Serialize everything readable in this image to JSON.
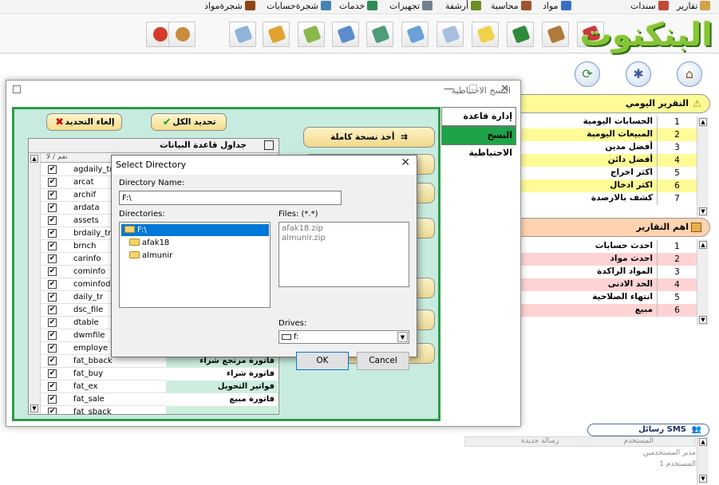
{
  "menu": [
    {
      "label": "تقارير",
      "icon": "report-icon",
      "color": "#d2a24a"
    },
    {
      "label": "سندات",
      "icon": "voucher-icon",
      "color": "#c04a3a"
    },
    {
      "label": "مواد",
      "icon": "items-icon",
      "color": "#3a6fc0"
    },
    {
      "label": "محاسبة",
      "icon": "accounting-icon",
      "color": "#a0522d"
    },
    {
      "label": "أرشفة",
      "icon": "archive-icon",
      "color": "#6b8e23"
    },
    {
      "label": "تجهيزات",
      "icon": "tools-icon",
      "color": "#708090"
    },
    {
      "label": "خدمات",
      "icon": "services-icon",
      "color": "#2e8b57"
    },
    {
      "label": "شجرةحسابات",
      "icon": "accounts-tree-icon",
      "color": "#4682b4"
    },
    {
      "label": "شجرةمواد",
      "icon": "items-tree-icon",
      "color": "#8b4513"
    }
  ],
  "logo_text": "البنكنوت",
  "backup_window": {
    "title": "النسخ الاحتياطية",
    "side_tabs": {
      "db_admin": "إدارة قاعدة البيانات",
      "backups": "النسخ الاحتياطية"
    },
    "select_all": "تحديد الكل",
    "cancel_selection": "إلغاء التحديد",
    "full_backup": "أخذ نسخة كاملة",
    "grid_title": "جداول قاعدة البيانات",
    "col_yes_no": "نعم / لا",
    "check_mark": "✔",
    "rows": [
      {
        "name": "agdaily_tr",
        "desc": ""
      },
      {
        "name": "arcat",
        "desc": ""
      },
      {
        "name": "archif",
        "desc": ""
      },
      {
        "name": "ardata",
        "desc": ""
      },
      {
        "name": "assets",
        "desc": ""
      },
      {
        "name": "brdaily_tr",
        "desc": ""
      },
      {
        "name": "brnch",
        "desc": ""
      },
      {
        "name": "carinfo",
        "desc": ""
      },
      {
        "name": "cominfo",
        "desc": ""
      },
      {
        "name": "cominfodai",
        "desc": ""
      },
      {
        "name": "daily_tr",
        "desc": ""
      },
      {
        "name": "dsc_file",
        "desc": ""
      },
      {
        "name": "dtable",
        "desc": ""
      },
      {
        "name": "dwmfile",
        "desc": ""
      },
      {
        "name": "employe",
        "desc": ""
      },
      {
        "name": "fat_bback",
        "desc": "فاتورة مرتجع شراء"
      },
      {
        "name": "fat_buy",
        "desc": "فاتورة شراء"
      },
      {
        "name": "fat_ex",
        "desc": "فواتير التحويل"
      },
      {
        "name": "fat_sale",
        "desc": "فاتورة مبيع"
      },
      {
        "name": "fat_sback",
        "desc": ""
      }
    ]
  },
  "dialog": {
    "title": "Select Directory",
    "close_glyph": "✕",
    "directory_name_label": "Directory Name:",
    "directory_name_value": "F:\\",
    "directories_label": "Directories:",
    "files_label": "Files: (*.*)",
    "directories": [
      "F:\\",
      "afak18",
      "almunir"
    ],
    "files": [
      "afak18.zip",
      "almunir.zip"
    ],
    "drives_label": "Drives:",
    "drive_value": "f:",
    "ok": "OK",
    "cancel": "Cancel"
  },
  "daily_reports": {
    "header": "التقرير اليومي",
    "accent": "#fffb96",
    "items": [
      {
        "label": "الحسابات اليومية",
        "num": "1"
      },
      {
        "label": "المبيعات اليومية",
        "num": "2"
      },
      {
        "label": "أفضل مدين",
        "num": "3"
      },
      {
        "label": "أفضل دائن",
        "num": "4"
      },
      {
        "label": "اكثر اخراج",
        "num": "5"
      },
      {
        "label": "اكثر ادخال",
        "num": "6"
      },
      {
        "label": "كشف بالارصدة",
        "num": "7"
      }
    ]
  },
  "top_reports": {
    "header": "اهم التقارير",
    "accent": "#ffd3d3",
    "items": [
      {
        "label": "احدث حسابات",
        "num": "1"
      },
      {
        "label": "احدث مواد",
        "num": "2"
      },
      {
        "label": "المواد الراكدة",
        "num": "3"
      },
      {
        "label": "الحد الادنى",
        "num": "4"
      },
      {
        "label": "انتهاء الصلاحية",
        "num": "5"
      },
      {
        "label": "مبيع",
        "num": "6"
      }
    ]
  },
  "sms": {
    "header": "رسائل SMS",
    "col_user": "المستخدم",
    "col_new": "رسالة جديدة",
    "rows": [
      "مدير المستخدمين",
      "المستخدم 1"
    ]
  }
}
